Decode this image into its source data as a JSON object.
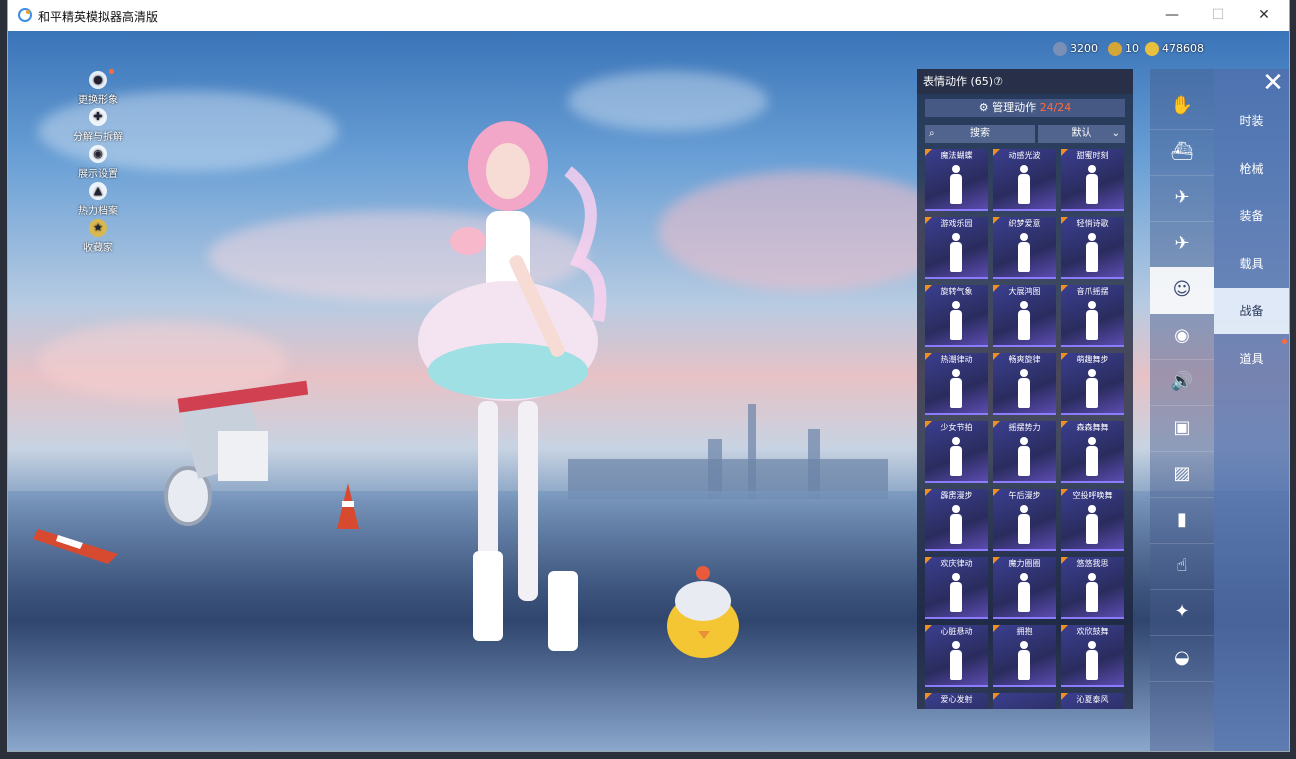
{
  "window": {
    "title": "和平精英模拟器高清版",
    "minimize": "—",
    "maximize": "☐",
    "close": "✕"
  },
  "left_menu": [
    {
      "label": "更换形象",
      "icon": "person-icon"
    },
    {
      "label": "分解与拆解",
      "icon": "puzzle-icon"
    },
    {
      "label": "展示设置",
      "icon": "eye-icon"
    },
    {
      "label": "热力档案",
      "icon": "flame-icon"
    },
    {
      "label": "收藏家",
      "icon": "collector-badge-icon"
    }
  ],
  "currency": [
    {
      "value": "3200",
      "color": "#7a8fb5"
    },
    {
      "value": "10",
      "color": "#d4a63a"
    },
    {
      "value": "478608",
      "color": "#e8c040"
    }
  ],
  "panel": {
    "header": "表情动作 (65)",
    "help": "⑦",
    "manage_label": "管理动作",
    "manage_count": "24/24",
    "search_label": "搜索",
    "sort_label": "默认"
  },
  "emotes": [
    "魔法蝴蝶",
    "动感光波",
    "甜蜜时刻",
    "游戏乐园",
    "织梦爱意",
    "轻悄诗歌",
    "旋转气象",
    "大展鸿图",
    "音爪摇摆",
    "热潮律动",
    "畅爽旋律",
    "萌趣舞步",
    "少女节拍",
    "摇摆势力",
    "森森舞舞",
    "霹雳漫步",
    "午后漫步",
    "空投呼唤舞",
    "欢庆律动",
    "魔力圈圈",
    "悠悠我思",
    "心脏悬动",
    "拥抱",
    "欢欣鼓舞",
    "爱心发射",
    "",
    "沁夏泰风"
  ],
  "categories": [
    "fan-icon",
    "boat-icon",
    "drone-icon",
    "plane-icon",
    "smile-icon",
    "robot-icon",
    "speaker-icon",
    "face-box-icon",
    "photo-icon",
    "extinguisher-icon",
    "tap-icon",
    "sparkle-icon",
    "hat-icon"
  ],
  "category_glyphs": [
    "✋",
    "⛴",
    "✈",
    "✈",
    "☺",
    "◉",
    "🔊",
    "▣",
    "▨",
    "▮",
    "☝",
    "✦",
    "◒"
  ],
  "active_category": 4,
  "tabs": [
    "时装",
    "枪械",
    "装备",
    "载具",
    "战备",
    "道具"
  ],
  "active_tab": 4
}
